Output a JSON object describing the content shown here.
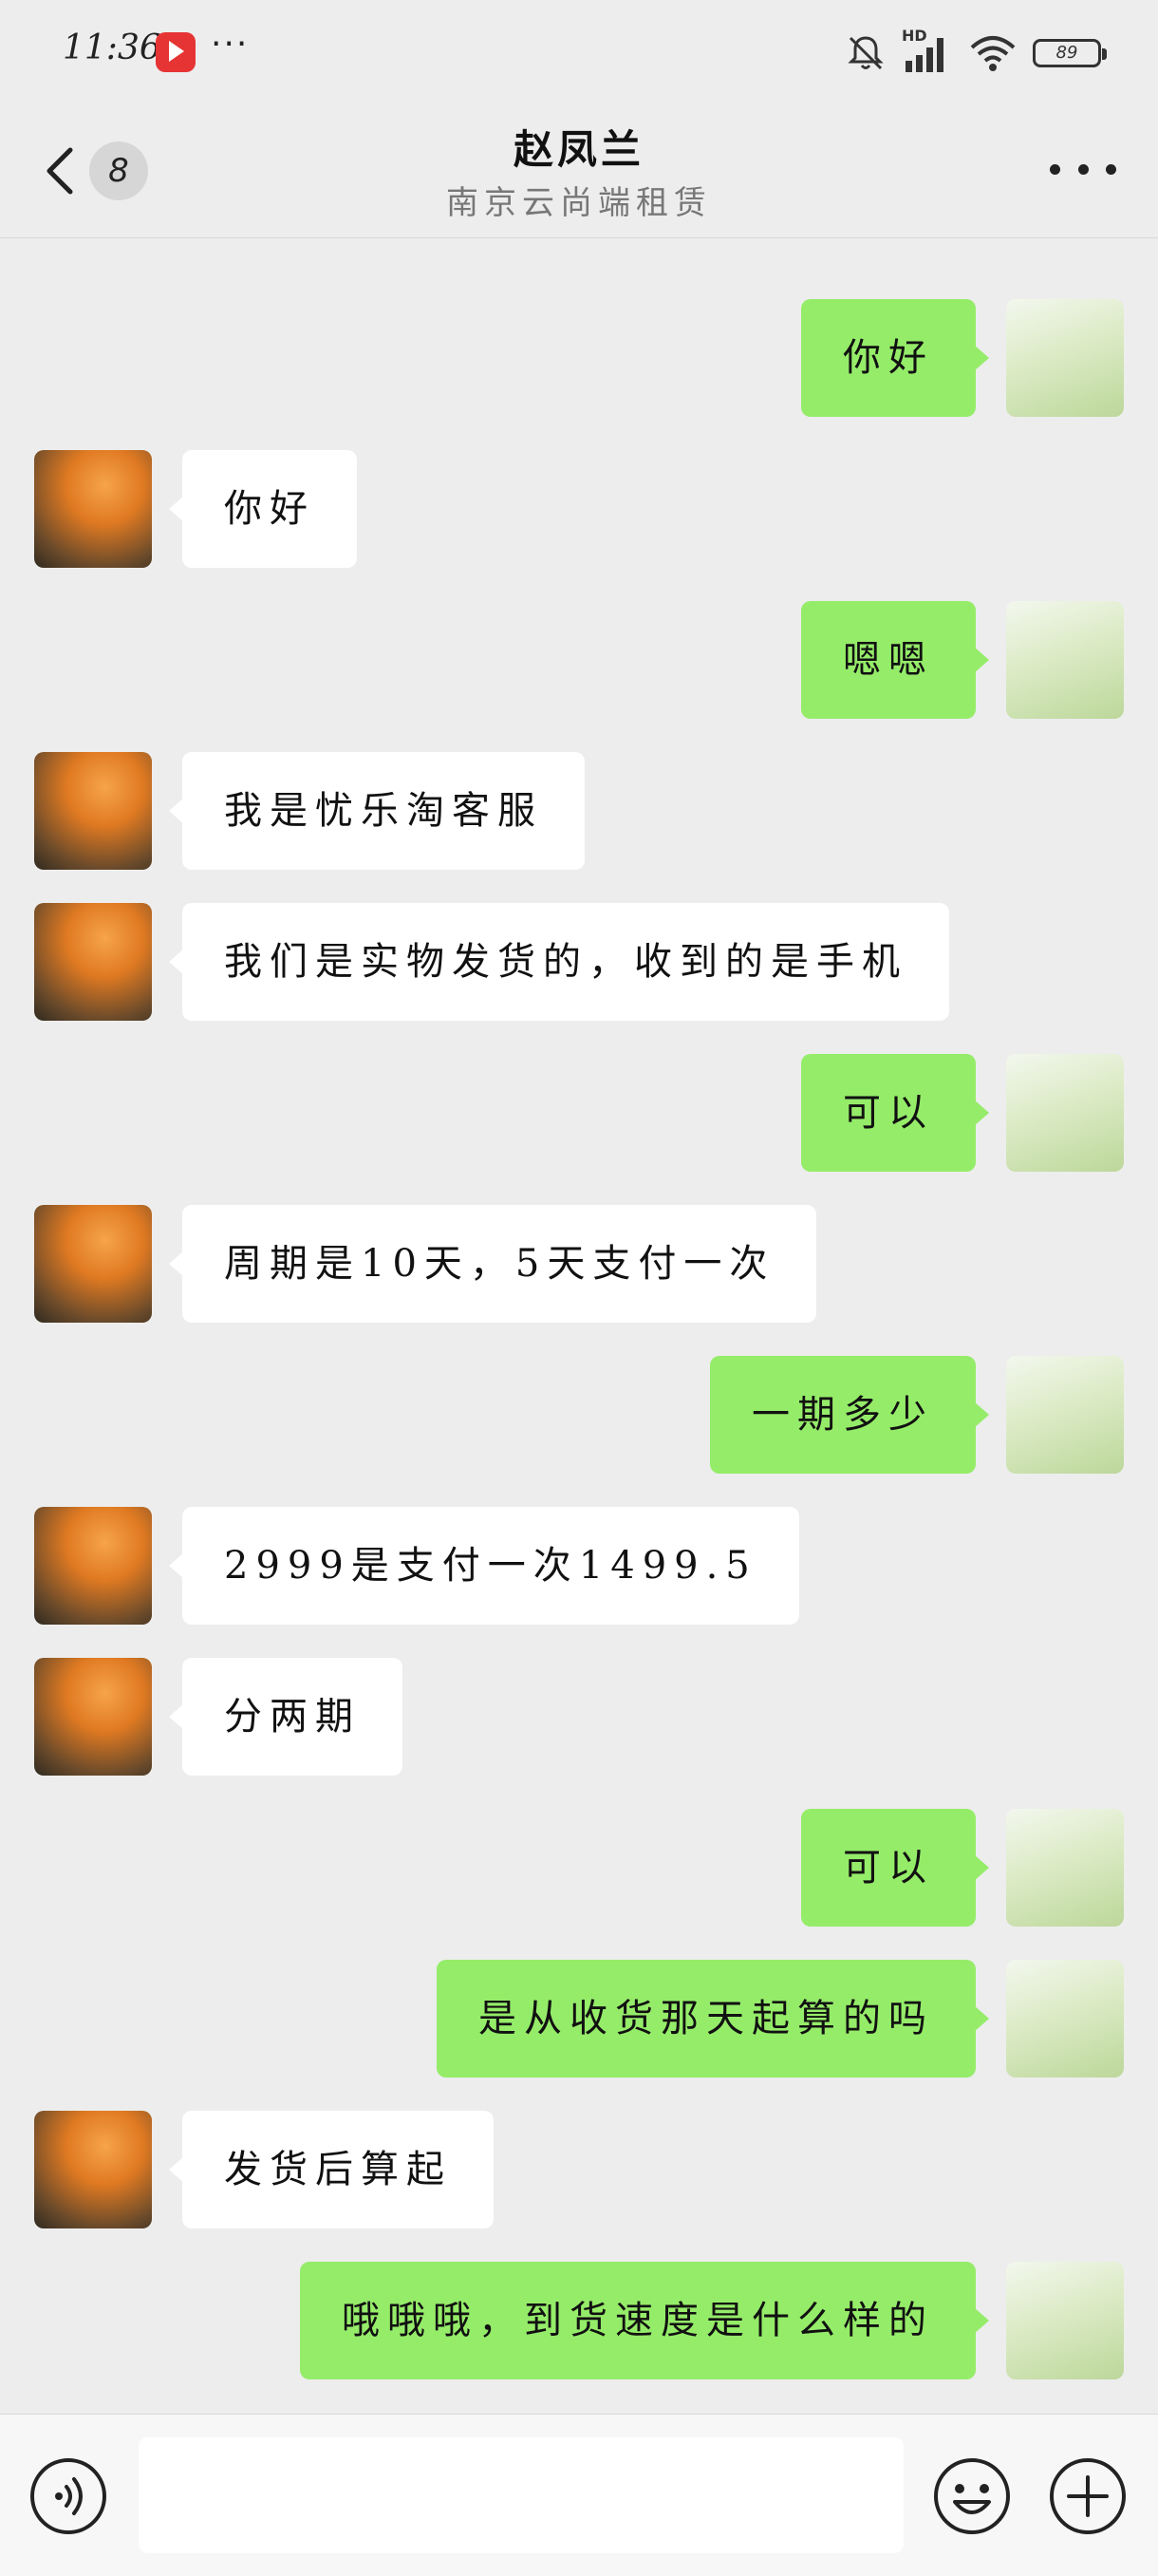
{
  "status_bar": {
    "time": "11:36",
    "network_label": "HD",
    "battery": "89"
  },
  "header": {
    "unread_count": "8",
    "title": "赵凤兰",
    "subtitle": "南京云尚端租赁"
  },
  "messages": [
    {
      "side": "sent",
      "text": "你好"
    },
    {
      "side": "recv",
      "text": "你好"
    },
    {
      "side": "sent",
      "text": "嗯嗯"
    },
    {
      "side": "recv",
      "text": "我是忧乐淘客服"
    },
    {
      "side": "recv",
      "text": "我们是实物发货的，收到的是手机"
    },
    {
      "side": "sent",
      "text": "可以"
    },
    {
      "side": "recv",
      "text": "周期是10天，5天支付一次"
    },
    {
      "side": "sent",
      "text": "一期多少"
    },
    {
      "side": "recv",
      "text": "2999是支付一次1499.5"
    },
    {
      "side": "recv",
      "text": "分两期"
    },
    {
      "side": "sent",
      "text": "可以"
    },
    {
      "side": "sent",
      "text": "是从收货那天起算的吗"
    },
    {
      "side": "recv",
      "text": "发货后算起"
    },
    {
      "side": "sent",
      "text": "哦哦哦，到货速度是什么样的"
    }
  ],
  "input_bar": {
    "placeholder": "",
    "voice_icon": "voice-icon",
    "emoji_icon": "emoji-icon",
    "plus_icon": "plus-icon"
  },
  "colors": {
    "background": "#ededed",
    "sent_bubble": "#95ec69",
    "recv_bubble": "#ffffff"
  }
}
